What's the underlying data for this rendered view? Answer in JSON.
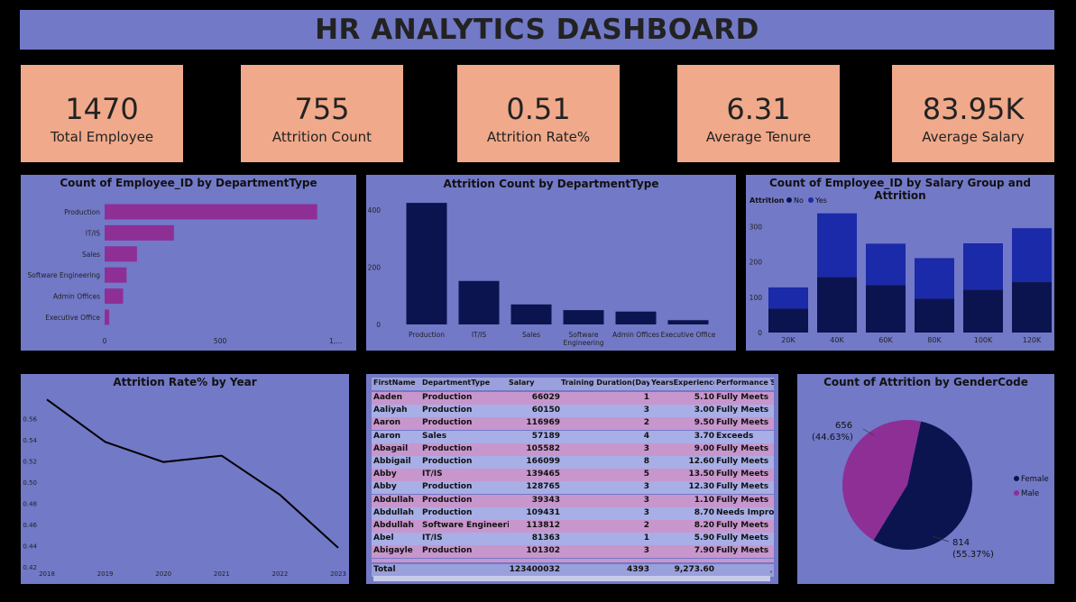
{
  "header": {
    "title": "HR ANALYTICS DASHBOARD"
  },
  "kpis": [
    {
      "value": "1470",
      "label": "Total Employee"
    },
    {
      "value": "755",
      "label": "Attrition Count"
    },
    {
      "value": "0.51",
      "label": "Attrition Rate%"
    },
    {
      "value": "6.31",
      "label": "Average Tenure"
    },
    {
      "value": "83.95K",
      "label": "Average Salary"
    }
  ],
  "colors": {
    "panel": "#7279c7",
    "kpi": "#f0a98a",
    "magenta": "#8e2f96",
    "navy": "#0c1450",
    "blue": "#1a2aa8"
  },
  "chart_data": [
    {
      "type": "bar",
      "orientation": "horizontal",
      "title": "Count of Employee_ID by DepartmentType",
      "categories": [
        "Production",
        "IT/IS",
        "Sales",
        "Software Engineering",
        "Admin Offices",
        "Executive Office"
      ],
      "values": [
        920,
        300,
        140,
        95,
        80,
        20
      ],
      "xticks": [
        "0",
        "500",
        "1,..."
      ],
      "xlim": [
        0,
        1050
      ]
    },
    {
      "type": "bar",
      "title": "Attrition Count by DepartmentType",
      "categories": [
        "Production",
        "IT/IS",
        "Sales",
        "Software Engineering",
        "Admin Offices",
        "Executive Office"
      ],
      "values": [
        425,
        152,
        70,
        50,
        45,
        15
      ],
      "yticks": [
        "0",
        "200",
        "400"
      ],
      "ylim": [
        0,
        460
      ]
    },
    {
      "type": "bar",
      "stacked": true,
      "title": "Count of Employee_ID by Salary Group and Attrition",
      "legend_title": "Attrition",
      "categories": [
        "20K",
        "40K",
        "60K",
        "80K",
        "100K",
        "120K"
      ],
      "series": [
        {
          "name": "No",
          "values": [
            68,
            157,
            135,
            96,
            122,
            143
          ]
        },
        {
          "name": "Yes",
          "values": [
            60,
            181,
            117,
            115,
            131,
            153
          ]
        }
      ],
      "yticks": [
        "0",
        "100",
        "200",
        "300"
      ],
      "ylim": [
        0,
        345
      ]
    },
    {
      "type": "line",
      "title": "Attrition Rate% by Year",
      "x": [
        "2018",
        "2019",
        "2020",
        "2021",
        "2022",
        "2023"
      ],
      "values": [
        0.578,
        0.538,
        0.519,
        0.525,
        0.488,
        0.438
      ],
      "yticks": [
        "0.42",
        "0.44",
        "0.46",
        "0.48",
        "0.50",
        "0.52",
        "0.54",
        "0.56"
      ],
      "ylim": [
        0.42,
        0.58
      ]
    },
    {
      "type": "table",
      "columns": [
        "FirstName",
        "DepartmentType",
        "Salary",
        "Training Duration(Days)",
        "YearsExperience",
        "Performance Sc"
      ],
      "rows": [
        [
          "Aaden",
          "Production",
          "66029",
          "1",
          "5.10",
          "Fully Meets"
        ],
        [
          "Aaliyah",
          "Production",
          "60150",
          "3",
          "3.00",
          "Fully Meets"
        ],
        [
          "Aaron",
          "Production",
          "116969",
          "2",
          "9.50",
          "Fully Meets"
        ],
        [
          "Aaron",
          "Sales",
          "57189",
          "4",
          "3.70",
          "Exceeds"
        ],
        [
          "Abagail",
          "Production",
          "105582",
          "3",
          "9.00",
          "Fully Meets"
        ],
        [
          "Abbigail",
          "Production",
          "166099",
          "8",
          "12.60",
          "Fully Meets"
        ],
        [
          "Abby",
          "IT/IS",
          "139465",
          "5",
          "13.50",
          "Fully Meets"
        ],
        [
          "Abby",
          "Production",
          "128765",
          "3",
          "12.30",
          "Fully Meets"
        ],
        [
          "Abdullah",
          "Production",
          "39343",
          "3",
          "1.10",
          "Fully Meets"
        ],
        [
          "Abdullah",
          "Production",
          "109431",
          "3",
          "8.70",
          "Needs Improve"
        ],
        [
          "Abdullah",
          "Software Engineering",
          "113812",
          "2",
          "8.20",
          "Fully Meets"
        ],
        [
          "Abel",
          "IT/IS",
          "81363",
          "1",
          "5.90",
          "Fully Meets"
        ],
        [
          "Abigayle",
          "Production",
          "101302",
          "3",
          "7.90",
          "Fully Meets"
        ]
      ],
      "total": [
        "Total",
        "",
        "123400032",
        "4393",
        "9,273.60",
        ""
      ]
    },
    {
      "type": "pie",
      "title": "Count of Attrition by GenderCode",
      "categories": [
        "Female",
        "Male"
      ],
      "values": [
        814,
        656
      ],
      "labels": [
        "814",
        "656"
      ],
      "pct_labels": [
        "(55.37%)",
        "(44.63%)"
      ]
    }
  ]
}
